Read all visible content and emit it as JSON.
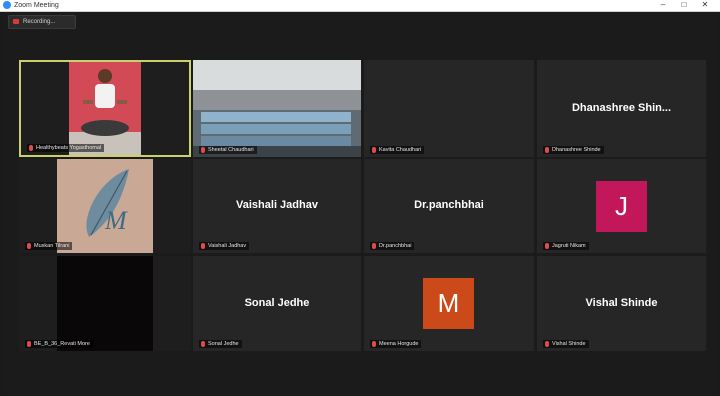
{
  "window": {
    "title": "Zoom Meeting",
    "minimize": "–",
    "maximize": "□",
    "close": "✕"
  },
  "recording": {
    "label": "Recording..."
  },
  "tiles": [
    {
      "name": "Healthybeats Yogasthomal"
    },
    {
      "name": "Sheetal Chaudhari"
    },
    {
      "name": "Kavita Chaudhari"
    },
    {
      "name": "Dhanashree Shinde",
      "display": "Dhanashree  Shin..."
    },
    {
      "name": "Muskan Tilrani"
    },
    {
      "name": "Vaishali Jadhav",
      "display": "Vaishali Jadhav"
    },
    {
      "name": "Dr.panchbhai",
      "display": "Dr.panchbhai"
    },
    {
      "name": "Jagruti Nikam",
      "avatar": "J",
      "avatar_color": "#c2185b"
    },
    {
      "name": "BE_B_36_Revati More"
    },
    {
      "name": "Sonal Jedhe",
      "display": "Sonal Jedhe"
    },
    {
      "name": "Meena Horgude",
      "avatar": "M",
      "avatar_color": "#cc4a1a"
    },
    {
      "name": "Vishal Shinde",
      "display": "Vishal Shinde"
    }
  ],
  "colors": {
    "active_border": "#c9d26a",
    "mic_off": "#e04a4a"
  }
}
